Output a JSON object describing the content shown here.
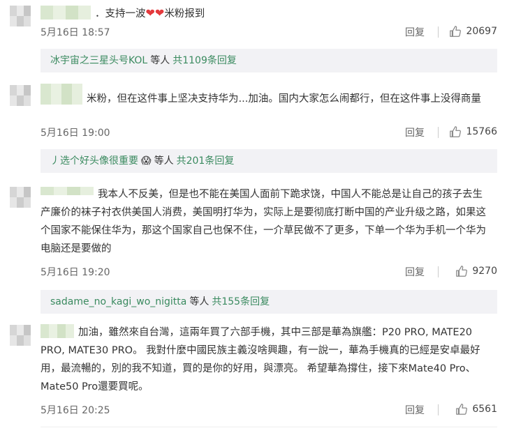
{
  "comments": [
    {
      "text_prefix": "．支持一波",
      "text_suffix": "米粉报到",
      "hearts": [
        "❤",
        "❤"
      ],
      "date": "5月16日 18:57",
      "reply_label": "回复",
      "likes": "20697",
      "sub_reply": {
        "user": "冰宇宙之三星头号KOL",
        "mid": "等人",
        "count": "共1109条回复"
      }
    },
    {
      "text": "米粉，但在这件事上坚决支持华为...加油。国内大家怎么闹都行，但在这件事上没得商量",
      "date": "5月16日 19:00",
      "reply_label": "回复",
      "likes": "15766",
      "sub_reply": {
        "user": "丿选个好头像很重要",
        "emoji": "😱",
        "mid": "等人",
        "count": "共201条回复"
      }
    },
    {
      "text": "我本人不反美，但是也不能在美国人面前下跪求饶，中国人不能总是让自己的孩子去生产廉价的袜子衬衣供美国人消费，美国明打华为，实际上是要彻底打断中国的产业升级之路，如果这个国家不能保住华为，那这个国家自己也保不住，一介草民做不了更多，下单一个华为手机一个华为电脑还是要做的",
      "date": "5月16日 19:20",
      "reply_label": "回复",
      "likes": "9270",
      "sub_reply": {
        "user": "sadame_no_kagi_wo_nigitta",
        "mid": "等人",
        "count": "共155条回复"
      }
    },
    {
      "text": "加油，雖然來自台灣，這兩年買了六部手機，其中三部是華為旗艦：P20 PRO, MATE20 PRO, MATE30 PRO。 我對什麼中國民族主義沒啥興趣，有一說一，華為手機真的已經是安卓最好用，最流暢的，別的我不知道，買的是你的好用，與漂亮。 希望華為撐住，接下來Mate40 Pro、Mate50 Pro還要買呢。",
      "date": "5月16日 20:25",
      "reply_label": "回复",
      "likes": "6561"
    }
  ],
  "colors": {
    "link_green": "#3a8a5f",
    "subbox_bg": "#f2f2f5"
  }
}
